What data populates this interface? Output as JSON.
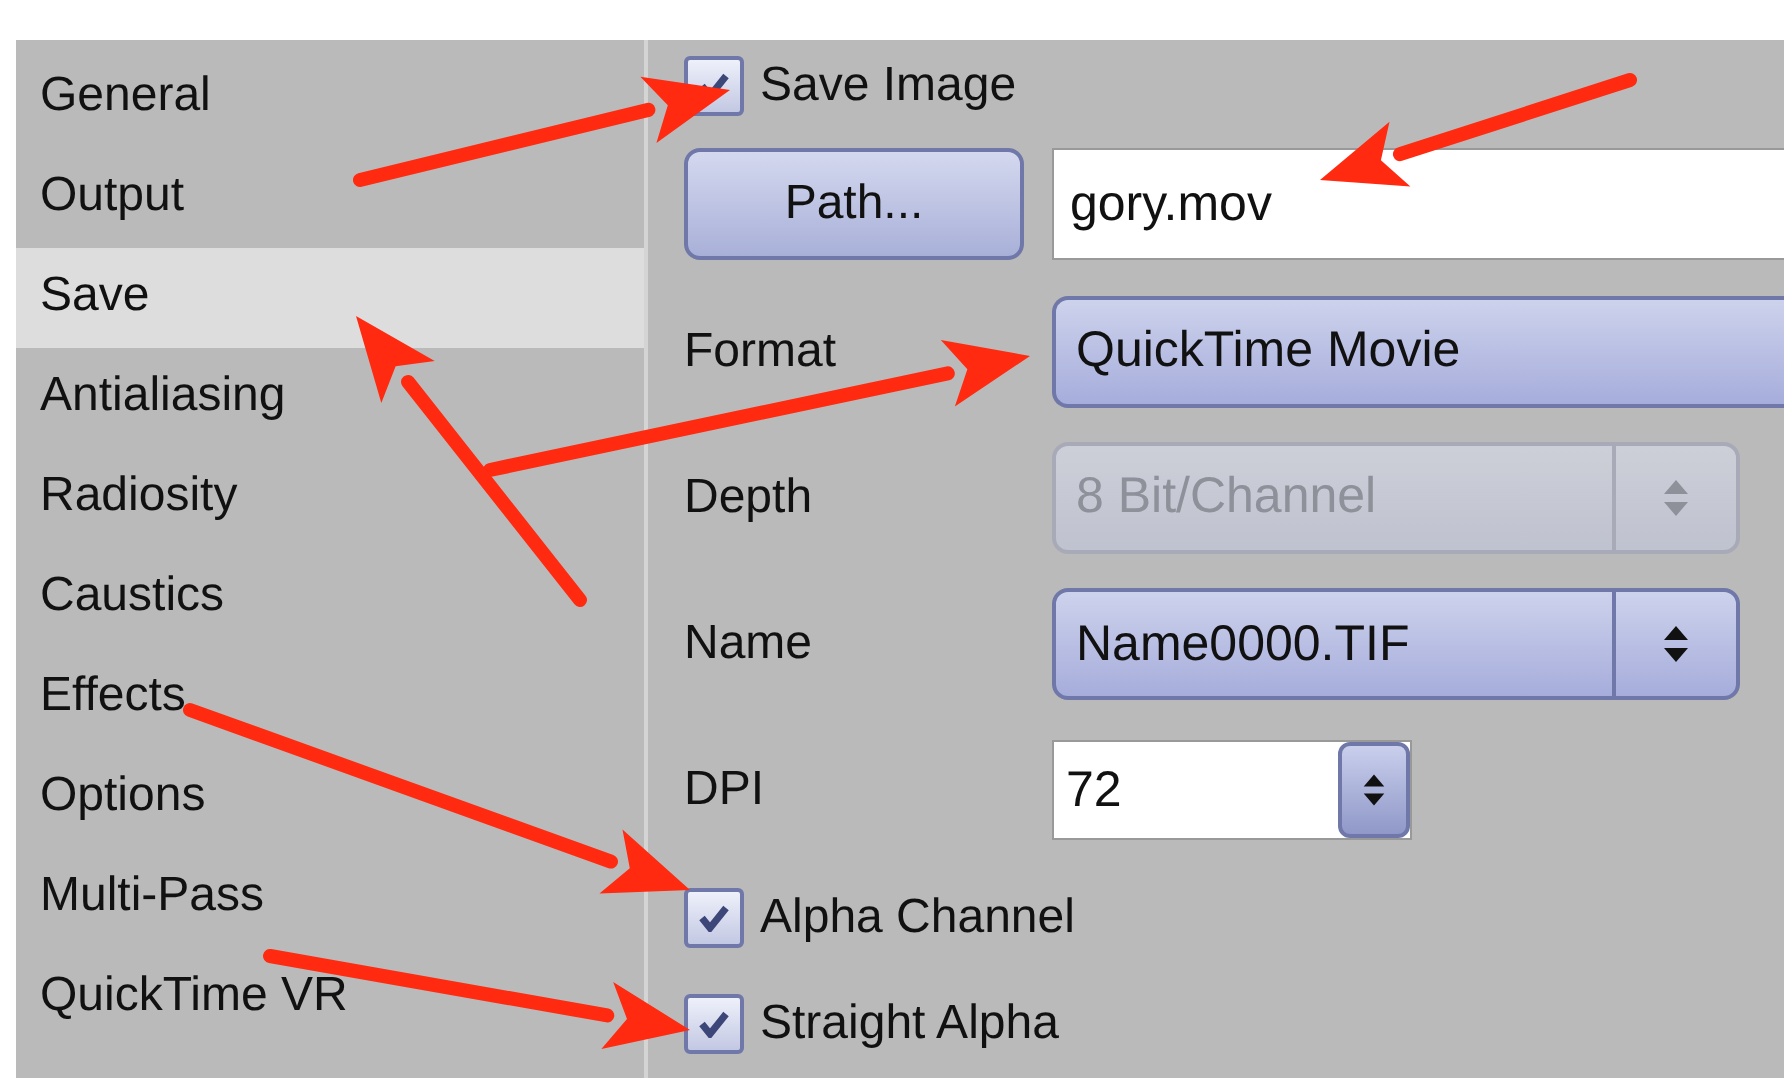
{
  "sidebar": {
    "items": [
      {
        "label": "General",
        "selected": false
      },
      {
        "label": "Output",
        "selected": false
      },
      {
        "label": "Save",
        "selected": true
      },
      {
        "label": "Antialiasing",
        "selected": false
      },
      {
        "label": "Radiosity",
        "selected": false
      },
      {
        "label": "Caustics",
        "selected": false
      },
      {
        "label": "Effects",
        "selected": false
      },
      {
        "label": "Options",
        "selected": false
      },
      {
        "label": "Multi-Pass",
        "selected": false
      },
      {
        "label": "QuickTime VR",
        "selected": false
      }
    ]
  },
  "save_image": {
    "label": "Save Image",
    "checked": true
  },
  "path": {
    "button": "Path...",
    "value": "gory.mov"
  },
  "fields": [
    {
      "kind": "popup",
      "label": "Format",
      "value": "QuickTime Movie",
      "disabled": false,
      "stepper": false
    },
    {
      "kind": "popup",
      "label": "Depth",
      "value": "8 Bit/Channel",
      "disabled": true,
      "stepper": true
    },
    {
      "kind": "popup",
      "label": "Name",
      "value": "Name0000.TIF",
      "disabled": false,
      "stepper": true
    },
    {
      "kind": "number",
      "label": "DPI",
      "value": "72",
      "disabled": false,
      "stepper": true
    }
  ],
  "options": [
    {
      "label": "Alpha Channel",
      "checked": true
    },
    {
      "label": "Straight Alpha",
      "checked": true
    }
  ]
}
